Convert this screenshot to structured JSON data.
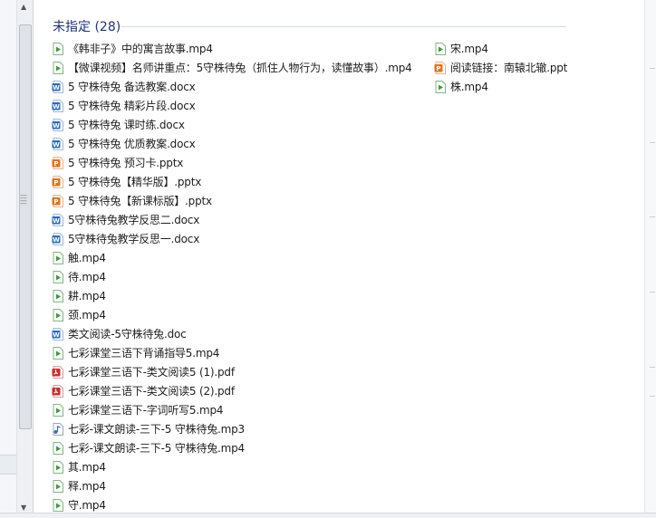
{
  "group": {
    "title": "未指定 (28)"
  },
  "columns": [
    [
      {
        "name": "《韩非子》中的寓言故事.mp4",
        "type": "video"
      },
      {
        "name": "【微课视频】名师讲重点：5守株待兔（抓住人物行为，读懂故事）.mp4",
        "type": "video"
      },
      {
        "name": "5 守株待兔 备选教案.docx",
        "type": "word"
      },
      {
        "name": "5 守株待兔 精彩片段.docx",
        "type": "word"
      },
      {
        "name": "5 守株待兔 课时练.docx",
        "type": "word"
      },
      {
        "name": "5 守株待兔 优质教案.docx",
        "type": "word"
      },
      {
        "name": "5 守株待兔 预习卡.pptx",
        "type": "ppt"
      },
      {
        "name": "5 守株待兔【精华版】.pptx",
        "type": "ppt"
      },
      {
        "name": "5 守株待兔【新课标版】.pptx",
        "type": "ppt"
      },
      {
        "name": "5守株待兔教学反思二.docx",
        "type": "word"
      },
      {
        "name": "5守株待兔教学反思一.docx",
        "type": "word"
      },
      {
        "name": "触.mp4",
        "type": "video"
      },
      {
        "name": "待.mp4",
        "type": "video"
      },
      {
        "name": "耕.mp4",
        "type": "video"
      },
      {
        "name": "颈.mp4",
        "type": "video"
      },
      {
        "name": "类文阅读-5守株待兔.doc",
        "type": "doc"
      },
      {
        "name": "七彩课堂三语下背诵指导5.mp4",
        "type": "video"
      },
      {
        "name": "七彩课堂三语下-类文阅读5 (1).pdf",
        "type": "pdf"
      },
      {
        "name": "七彩课堂三语下-类文阅读5 (2).pdf",
        "type": "pdf"
      },
      {
        "name": "七彩课堂三语下-字词听写5.mp4",
        "type": "video"
      },
      {
        "name": "七彩-课文朗读-三下-5 守株待兔.mp3",
        "type": "audio"
      },
      {
        "name": "七彩-课文朗读-三下-5 守株待兔.mp4",
        "type": "video"
      },
      {
        "name": "其.mp4",
        "type": "video"
      },
      {
        "name": "释.mp4",
        "type": "video"
      },
      {
        "name": "守.mp4",
        "type": "video"
      }
    ],
    [
      {
        "name": "宋.mp4",
        "type": "video"
      },
      {
        "name": "阅读链接：南辕北辙.ppt",
        "type": "ppt"
      },
      {
        "name": "株.mp4",
        "type": "video"
      }
    ]
  ],
  "icon_names": {
    "video": "video-file-icon",
    "word": "word-docx-icon",
    "doc": "word-doc-icon",
    "ppt": "powerpoint-file-icon",
    "pdf": "pdf-file-icon",
    "audio": "audio-file-icon"
  },
  "colors": {
    "header": "#1e3287",
    "video": "#3a9c3a",
    "word": "#2b6cc4",
    "ppt": "#e2731c",
    "pdf": "#d12b2b"
  }
}
